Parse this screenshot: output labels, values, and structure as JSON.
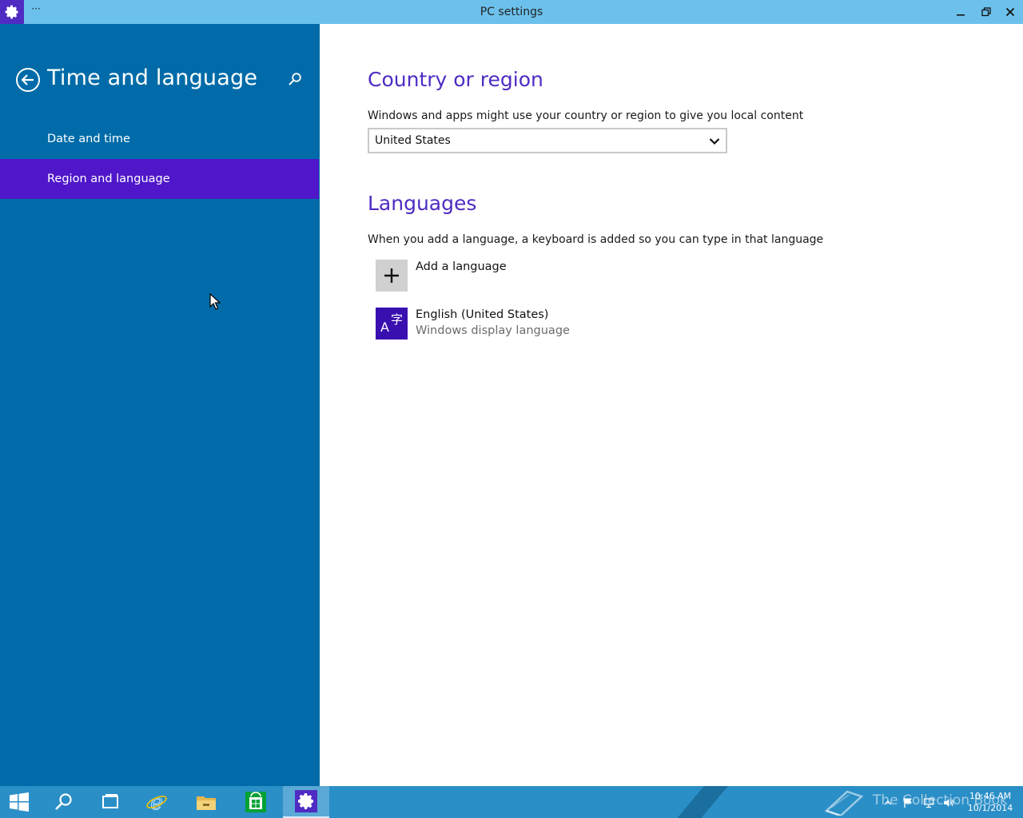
{
  "window": {
    "title": "PC settings",
    "more_label": "···"
  },
  "sidebar": {
    "title": "Time and language",
    "items": [
      {
        "label": "Date and time",
        "selected": false
      },
      {
        "label": "Region and language",
        "selected": true
      }
    ]
  },
  "main": {
    "country": {
      "heading": "Country or region",
      "description": "Windows and apps might use your country or region to give you local content",
      "selected": "United States"
    },
    "languages": {
      "heading": "Languages",
      "description": "When you add a language, a keyboard is added so you can type in that language",
      "add_label": "Add a language",
      "items": [
        {
          "name": "English (United States)",
          "detail": "Windows display language",
          "tile_glyphs": [
            "A",
            "字"
          ]
        }
      ]
    }
  },
  "taskbar": {
    "apps": [
      "start-icon",
      "search-icon",
      "task-view-icon",
      "internet-explorer-icon",
      "file-explorer-icon",
      "store-icon",
      "settings-icon"
    ],
    "watermark": "The Collection Book",
    "clock_time": "10:46 AM",
    "clock_date": "10/1/2014"
  },
  "colors": {
    "title_bar": "#6cc1ec",
    "sidebar": "#006ba8",
    "selection": "#4f17c9",
    "accent": "#4f2bc3",
    "taskbar": "#2b8fc7"
  }
}
